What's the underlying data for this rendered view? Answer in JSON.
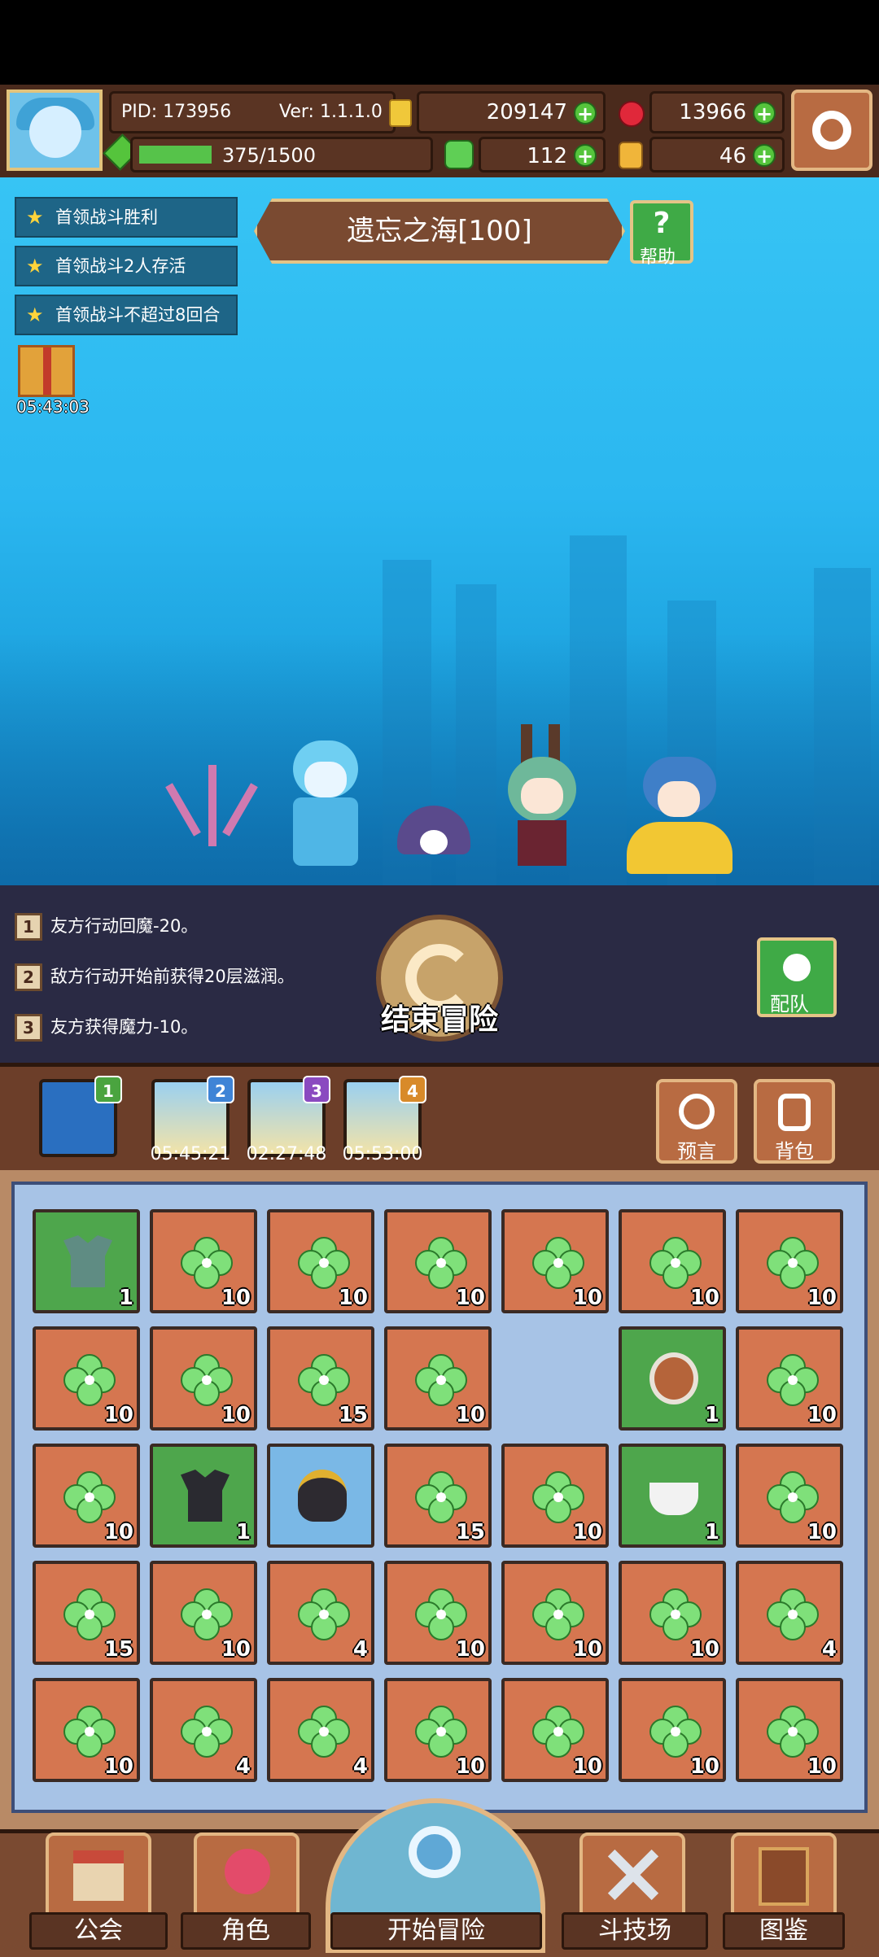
{
  "header": {
    "pid": "PID: 173956",
    "version": "Ver: 1.1.1.0",
    "gold": "209147",
    "gems": "13966",
    "energy": "375/1500",
    "energy_fraction": 0.25,
    "clover": "112",
    "tickets": "46"
  },
  "quests": [
    {
      "label": "首领战斗胜利"
    },
    {
      "label": "首领战斗2人存活"
    },
    {
      "label": "首领战斗不超过8回合"
    }
  ],
  "stage": {
    "title": "遗忘之海[100]",
    "help_label": "帮助"
  },
  "gift": {
    "timer": "05:43:03"
  },
  "logs": [
    {
      "num": "1",
      "text": "友方行动回魔-20。"
    },
    {
      "num": "2",
      "text": "敌方行动开始前获得20层滋润。"
    },
    {
      "num": "3",
      "text": "友方获得魔力-10。"
    }
  ],
  "end_button": {
    "label": "结束冒险"
  },
  "team_button": {
    "label": "配队"
  },
  "slots": [
    {
      "badge": "1",
      "timer": ""
    },
    {
      "badge": "2",
      "timer": "05:45:21"
    },
    {
      "badge": "3",
      "timer": "02:27:48"
    },
    {
      "badge": "4",
      "timer": "05:53:00"
    }
  ],
  "side_buttons": {
    "prophecy": "预言",
    "backpack": "背包"
  },
  "inventory": [
    [
      {
        "type": "armor",
        "bg": "green",
        "qty": "1"
      },
      {
        "type": "clover",
        "bg": "orange",
        "qty": "10"
      },
      {
        "type": "clover",
        "bg": "orange",
        "qty": "10"
      },
      {
        "type": "clover",
        "bg": "orange",
        "qty": "10"
      },
      {
        "type": "clover",
        "bg": "orange",
        "qty": "10"
      },
      {
        "type": "clover",
        "bg": "orange",
        "qty": "10"
      },
      {
        "type": "clover",
        "bg": "orange",
        "qty": "10"
      }
    ],
    [
      {
        "type": "clover",
        "bg": "orange",
        "qty": "10"
      },
      {
        "type": "clover",
        "bg": "orange",
        "qty": "10"
      },
      {
        "type": "clover",
        "bg": "orange",
        "qty": "15"
      },
      {
        "type": "clover",
        "bg": "orange",
        "qty": "10"
      },
      {
        "type": "empty",
        "bg": "empty",
        "qty": ""
      },
      {
        "type": "shield",
        "bg": "green",
        "qty": "1"
      },
      {
        "type": "clover",
        "bg": "orange",
        "qty": "10"
      }
    ],
    [
      {
        "type": "clover",
        "bg": "orange",
        "qty": "10"
      },
      {
        "type": "dark-armor",
        "bg": "green",
        "qty": "1"
      },
      {
        "type": "cauldron",
        "bg": "blue",
        "qty": ""
      },
      {
        "type": "clover",
        "bg": "orange",
        "qty": "15"
      },
      {
        "type": "clover",
        "bg": "orange",
        "qty": "10"
      },
      {
        "type": "belt",
        "bg": "green",
        "qty": "1"
      },
      {
        "type": "clover",
        "bg": "orange",
        "qty": "10"
      }
    ],
    [
      {
        "type": "clover",
        "bg": "orange",
        "qty": "15"
      },
      {
        "type": "clover",
        "bg": "orange",
        "qty": "10"
      },
      {
        "type": "clover",
        "bg": "orange",
        "qty": "4"
      },
      {
        "type": "clover",
        "bg": "orange",
        "qty": "10"
      },
      {
        "type": "clover",
        "bg": "orange",
        "qty": "10"
      },
      {
        "type": "clover",
        "bg": "orange",
        "qty": "10"
      },
      {
        "type": "clover",
        "bg": "orange",
        "qty": "4"
      }
    ],
    [
      {
        "type": "clover",
        "bg": "orange",
        "qty": "10"
      },
      {
        "type": "clover",
        "bg": "orange",
        "qty": "4"
      },
      {
        "type": "clover",
        "bg": "orange",
        "qty": "4"
      },
      {
        "type": "clover",
        "bg": "orange",
        "qty": "10"
      },
      {
        "type": "clover",
        "bg": "orange",
        "qty": "10"
      },
      {
        "type": "clover",
        "bg": "orange",
        "qty": "10"
      },
      {
        "type": "clover",
        "bg": "orange",
        "qty": "10"
      }
    ]
  ],
  "nav": {
    "guild": "公会",
    "character": "角色",
    "start": "开始冒险",
    "arena": "斗技场",
    "codex": "图鉴"
  }
}
